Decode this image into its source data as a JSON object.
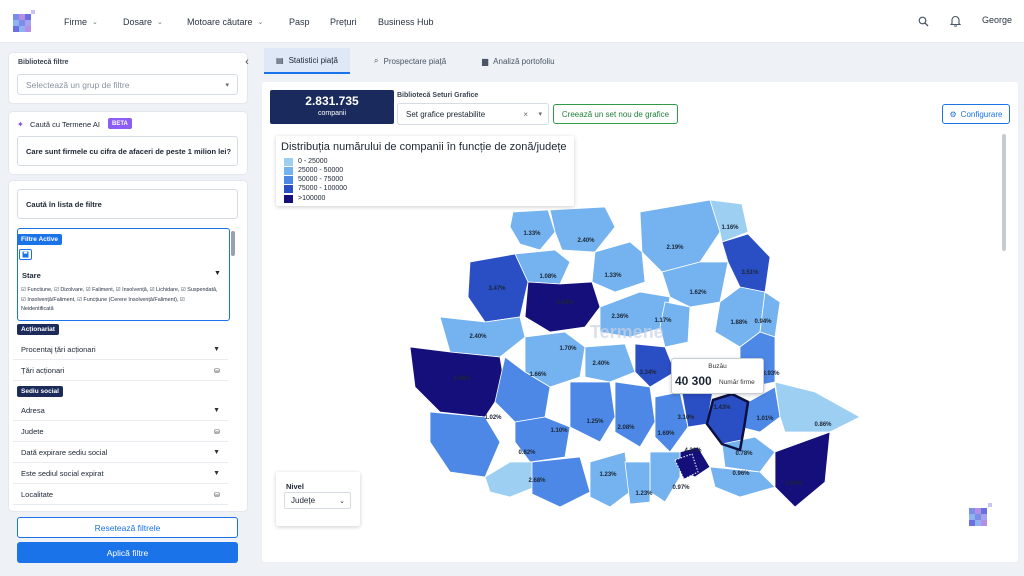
{
  "header": {
    "nav": [
      {
        "label": "Firme",
        "chev": true
      },
      {
        "label": "Dosare",
        "chev": true
      },
      {
        "label": "Motoare căutare",
        "chev": true
      },
      {
        "label": "Pasp",
        "chev": false
      },
      {
        "label": "Prețuri",
        "chev": false
      },
      {
        "label": "Business Hub",
        "chev": false
      }
    ],
    "user": "George"
  },
  "sidebar": {
    "library_label": "Bibliotecă filtre",
    "library_placeholder": "Selectează un grup de filtre",
    "ai_label": "Caută cu Termene AI",
    "ai_badge": "BETA",
    "ai_prompt": "Care sunt firmele cu cifra de afaceri de peste 1 milion lei?",
    "search_filters": "Caută în lista de filtre",
    "active_tag": "Filtre Active",
    "status_label": "Stare",
    "status_values": "☑ Functiune, ☑ Dizolvare, ☑ Faliment, ☑ Insolvență, ☑ Lichidare, ☑ Suspendată, ☑ Insolvență/Faliment, ☑ Funcțiune (Cerere Insolvență/Faliment), ☑ Neidentificată",
    "group1": "Acționariat",
    "rows1": [
      "Procentaj țări acționari",
      "Țări acționari"
    ],
    "group2": "Sediu social",
    "rows2": [
      "Adresa",
      "Judete",
      "Dată expirare sediu social",
      "Este sediul social expirat",
      "Localitate"
    ],
    "reset": "Resetează filtrele",
    "apply": "Aplică filtre"
  },
  "tabs": [
    "Statistici piață",
    "Prospectare piață",
    "Analiză portofoliu"
  ],
  "stats": {
    "count": "2.831.735",
    "count_label": "companii"
  },
  "chart_set": {
    "label": "Bibliotecă Seturi Grafice",
    "value": "Set grafice prestabilite",
    "create": "Creează un set nou de grafice",
    "configure": "Configurare"
  },
  "chart_data": {
    "type": "choropleth",
    "title": "Distribuția numărului de companii în funcție de zonă/județe",
    "legend": [
      {
        "label": "0 - 25000",
        "color": "#9dcff3"
      },
      {
        "label": "25000 - 50000",
        "color": "#74b3ef"
      },
      {
        "label": "50000 - 75000",
        "color": "#4d88e6"
      },
      {
        "label": "75000 - 100000",
        "color": "#2a4fc5"
      },
      {
        "label": ">100000",
        "color": "#140f7a"
      }
    ],
    "labels": [
      "1.33%",
      "2.40%",
      "2.19%",
      "1.16%",
      "1.08%",
      "1.33%",
      "3.51%",
      "3.47%",
      "5.43%",
      "1.62%",
      "2.36%",
      "1.17%",
      "1.88%",
      "0.94%",
      "2.40%",
      "1.70%",
      "2.40%",
      "3.34%",
      "4.48%",
      "1.66%",
      "3.93%",
      "1.02%",
      "1.10%",
      "1.25%",
      "2.08%",
      "1.69%",
      "3.10%",
      "1.43%",
      "1.01%",
      "0.86%",
      "0.82%",
      "4.36%",
      "0.78%",
      "2.68%",
      "1.23%",
      "0.97%",
      "0.96%",
      "3.69%",
      "1.23%"
    ],
    "tooltip": {
      "region": "Buzău",
      "value": "40 300",
      "unit": "Număr firme"
    },
    "watermark": "Termene"
  },
  "level": {
    "label": "Nivel",
    "value": "Județe"
  }
}
